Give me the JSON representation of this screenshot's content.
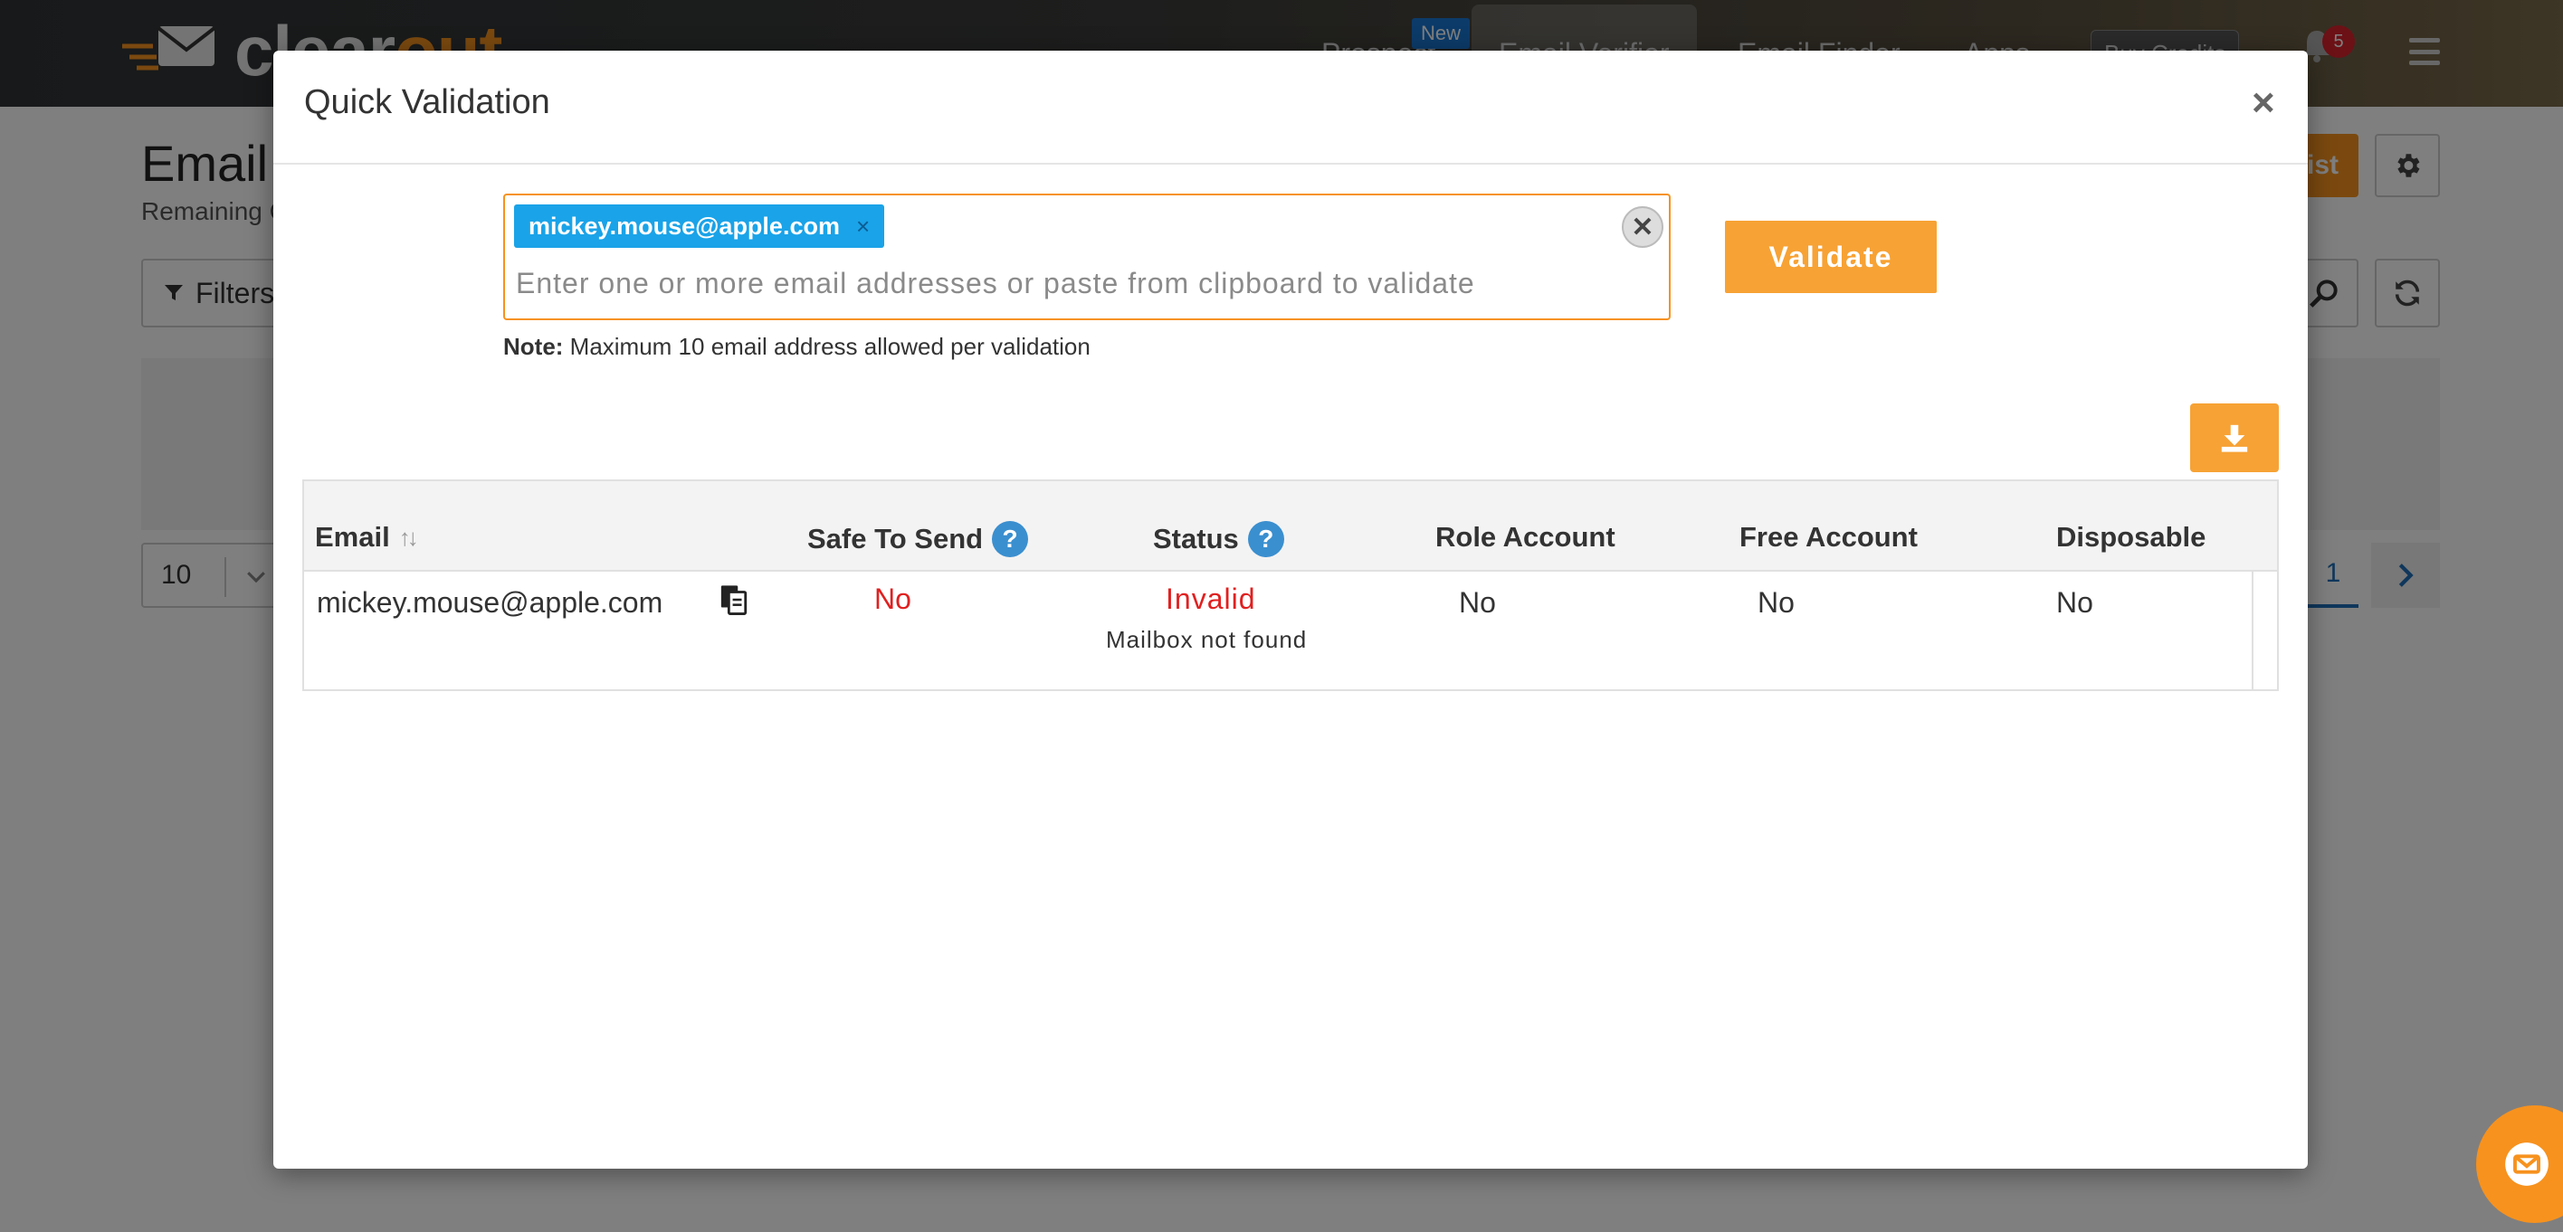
{
  "app": {
    "logo_text_main": "clear",
    "logo_text_accent": "out",
    "nav": [
      {
        "label": "Prospect",
        "badge": "New"
      },
      {
        "label": "Email Verifier"
      },
      {
        "label": "Email Finder"
      },
      {
        "label": "Apps"
      }
    ],
    "buy_credits": "Buy Credits",
    "notification_count": "5",
    "page_title": "Email Verifier",
    "page_subtitle": "Remaining Credits",
    "add_list_label": "ist",
    "filters_label": "Filters",
    "per_page": "10",
    "current_page": "1"
  },
  "modal": {
    "title": "Quick Validation",
    "close": "×",
    "input": {
      "tags": [
        "mickey.mouse@apple.com"
      ],
      "tag_remove": "×",
      "placeholder": "Enter one or more email addresses or paste from clipboard to validate",
      "clear": "✕"
    },
    "validate_label": "Validate",
    "note_label": "Note:",
    "note_text": " Maximum 10 email address allowed per validation",
    "table": {
      "headers": {
        "email": "Email",
        "safe_to_send": "Safe To Send",
        "status": "Status",
        "role_account": "Role Account",
        "free_account": "Free Account",
        "disposable": "Disposable"
      },
      "help": "?",
      "rows": [
        {
          "email": "mickey.mouse@apple.com",
          "safe_to_send": "No",
          "status": "Invalid",
          "status_reason": "Mailbox not found",
          "role_account": "No",
          "free_account": "No",
          "disposable": "No"
        }
      ]
    }
  },
  "colors": {
    "accent_orange": "#f7a234",
    "tag_blue": "#1aa3e8",
    "invalid_red": "#e02020",
    "help_blue": "#3a8fcf"
  }
}
